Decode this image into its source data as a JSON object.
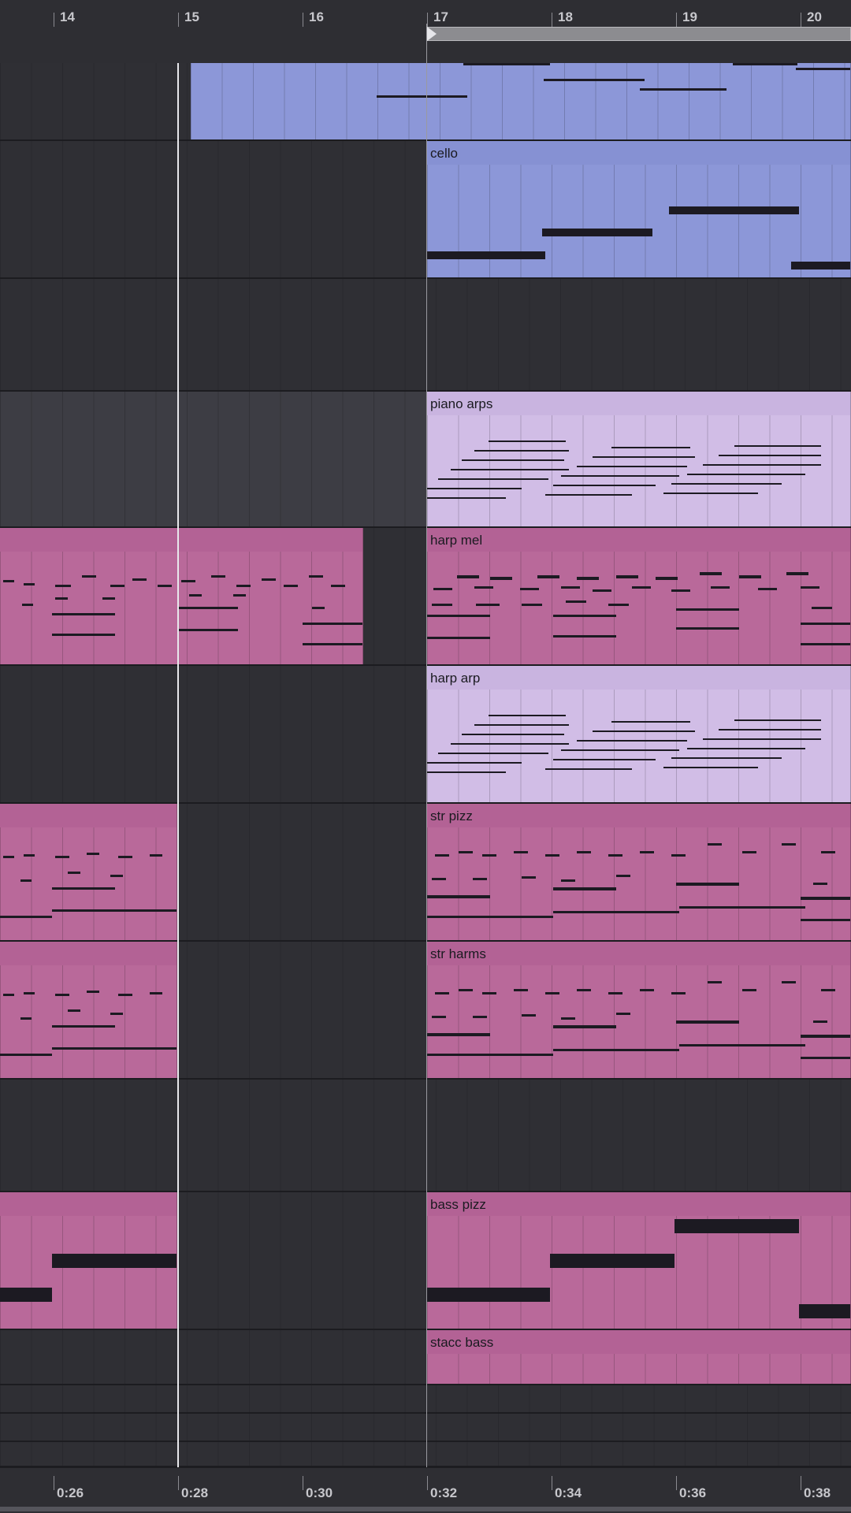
{
  "ruler": {
    "bars": [
      "14",
      "15",
      "16",
      "17",
      "18",
      "19",
      "20"
    ]
  },
  "time_ruler": {
    "labels": [
      "0:26",
      "0:28",
      "0:30",
      "0:32",
      "0:34",
      "0:36",
      "0:38"
    ]
  },
  "tracks": {
    "cello": "cello",
    "piano_arps": "piano arps",
    "harp_mel": "harp mel",
    "harp_arp": "harp arp",
    "str_pizz": "str pizz",
    "str_harms": "str harms",
    "bass_pizz": "bass pizz",
    "stacc_bass": "stacc bass"
  },
  "colors": {
    "blue_clip": "#8c97d8",
    "lilac_clip": "#d1bde6",
    "rose_clip": "#b9699a",
    "background": "#2c2c31",
    "playhead": "#e8e8ec"
  },
  "icons": {
    "loop_start": "play-triangle-icon"
  }
}
